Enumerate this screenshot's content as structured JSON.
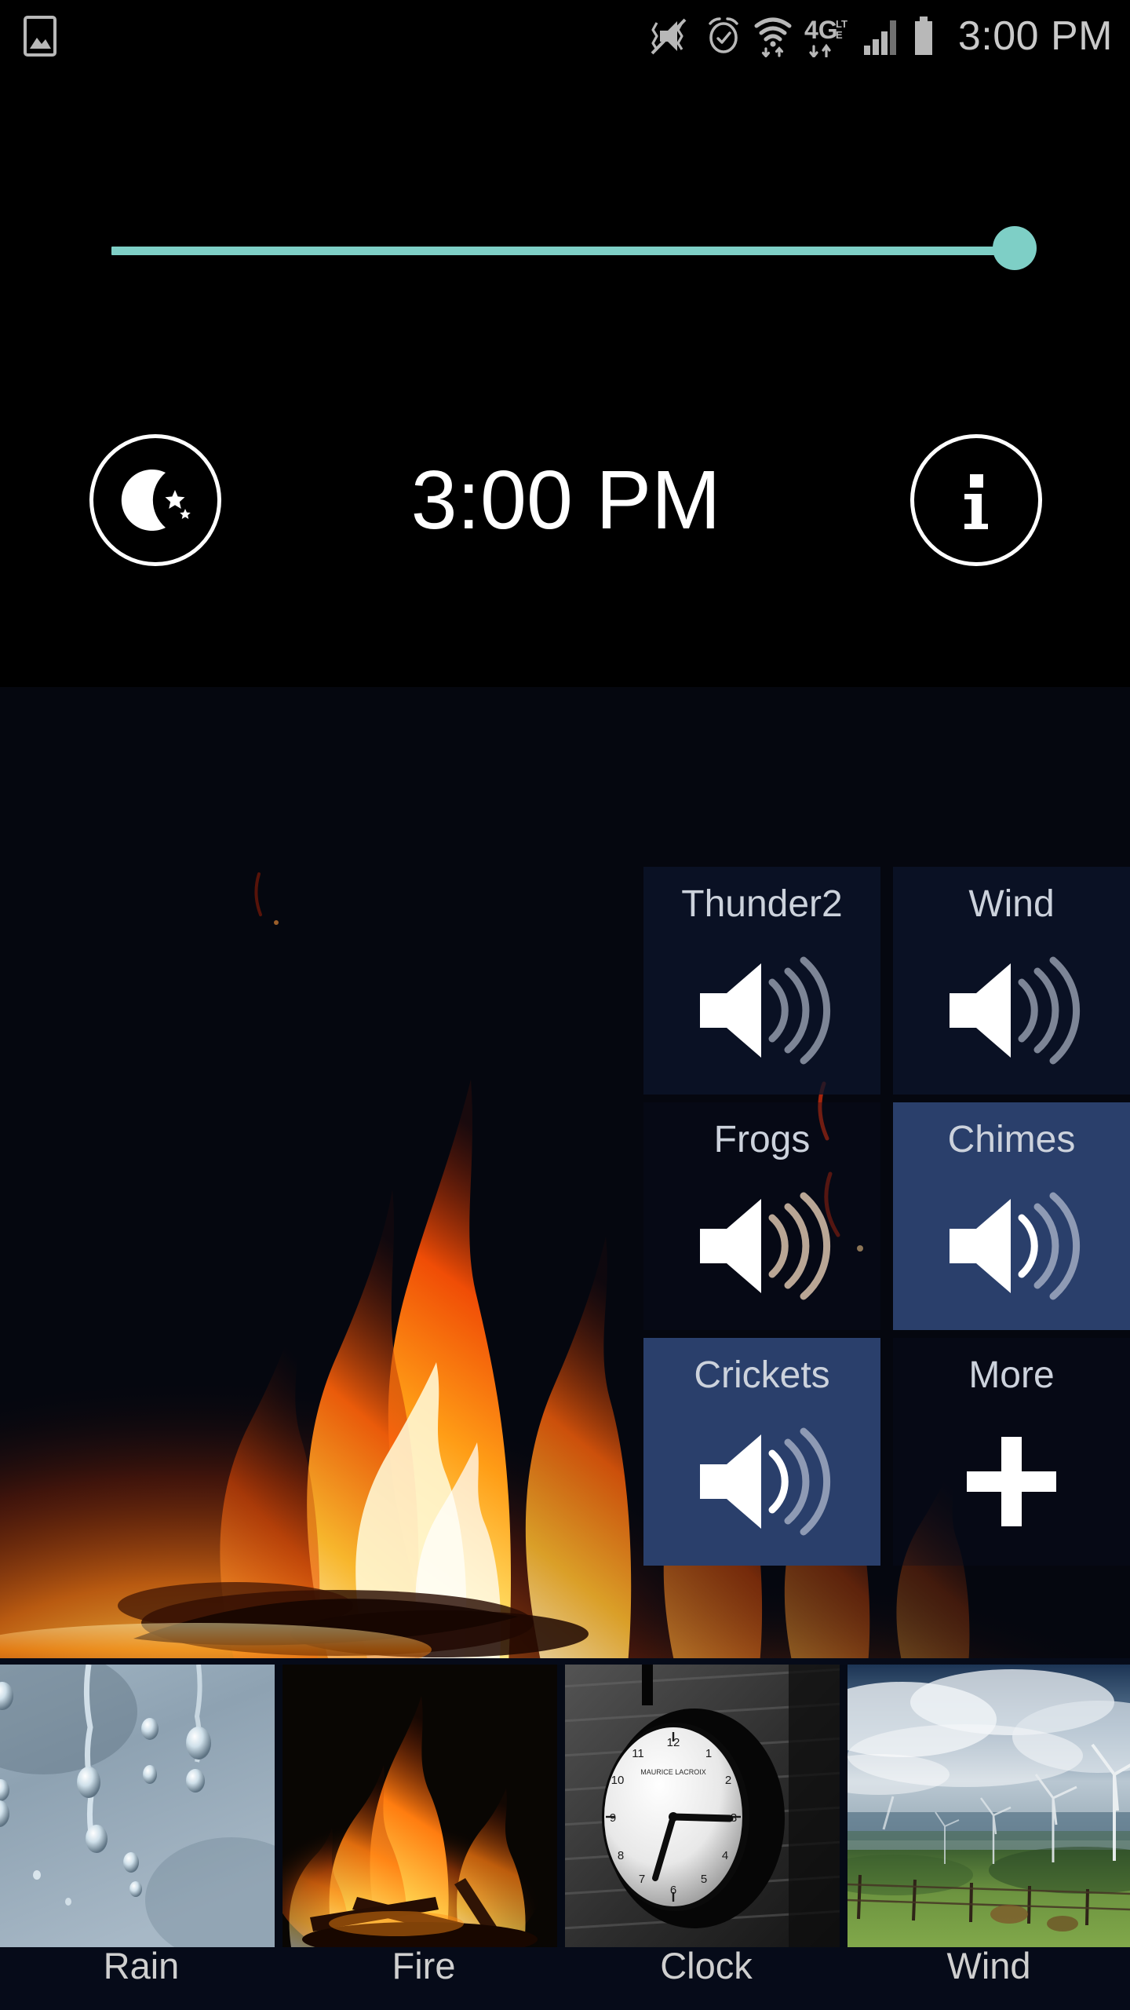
{
  "status_bar": {
    "icons": [
      "image-gallery-icon",
      "vibrate-mute-icon",
      "alarm-clock-icon",
      "wifi-icon",
      "4g-lte-icon",
      "signal-bars-icon",
      "battery-icon"
    ],
    "network_label": "4G",
    "network_sub": "LTE",
    "clock": "3:00 PM"
  },
  "top_panel": {
    "volume_slider": {
      "name": "volume-slider",
      "value": 100,
      "min": 0,
      "max": 100,
      "track_color": "#7ecfc6",
      "thumb_color": "#7ecfc6"
    },
    "night_mode_button": {
      "icon": "moon-stars-icon",
      "label": "Night mode"
    },
    "clock_display": "3:00 PM",
    "info_button": {
      "icon": "info-icon",
      "label": "Info"
    }
  },
  "background": {
    "name": "fire-background",
    "scene": "Fire"
  },
  "sound_tiles": [
    {
      "label": "Thunder2",
      "icon": "speaker-volume-icon",
      "active": false,
      "transparent": false
    },
    {
      "label": "Wind",
      "icon": "speaker-volume-icon",
      "active": false,
      "transparent": false
    },
    {
      "label": "Frogs",
      "icon": "speaker-volume-icon",
      "active": false,
      "transparent": true
    },
    {
      "label": "Chimes",
      "icon": "speaker-volume-icon",
      "active": true,
      "transparent": false
    },
    {
      "label": "Crickets",
      "icon": "speaker-volume-icon",
      "active": true,
      "transparent": false
    },
    {
      "label": "More",
      "icon": "plus-icon",
      "active": false,
      "transparent": true
    }
  ],
  "scene_strip": [
    {
      "label": "Rain",
      "thumb": "rain-droplets-thumbnail"
    },
    {
      "label": "Fire",
      "thumb": "campfire-thumbnail"
    },
    {
      "label": "Clock",
      "thumb": "wall-clock-thumbnail"
    },
    {
      "label": "Wind",
      "thumb": "wind-turbines-thumbnail"
    }
  ],
  "colors": {
    "accent": "#7ecfc6",
    "tile_active": "#2a3f6b",
    "tile_idle": "#0c142a",
    "strip_bg": "#060b19",
    "text": "#ffffff"
  }
}
